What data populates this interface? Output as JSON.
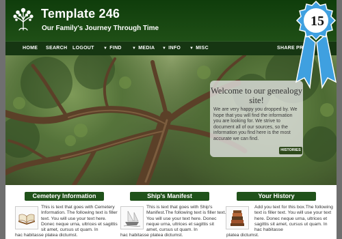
{
  "site": {
    "title": "Template 246",
    "tagline": "Our Family's Journey Through Time"
  },
  "nav": {
    "home": "HOME",
    "search": "SEARCH",
    "logout": "LOGOUT",
    "find": "FIND",
    "media": "MEDIA",
    "info": "INFO",
    "misc": "MISC",
    "share": "SHARE",
    "print": "PRINT"
  },
  "badge": {
    "number": "15"
  },
  "welcome": {
    "title": "Welcome to our genealogy site!",
    "text": "We are very happy you dropped by. We hope that you will find the information you are looking for. We strive to document all of our sources, so the information you find here is the most accurate we can find.",
    "button": "HISTORIES"
  },
  "columns": [
    {
      "heading": "Cemetery Information",
      "icon": "book-icon",
      "text": "This is text that goes with Cemetery Information. The following text is filler text. You will use your text here. Donec neque urna, ultrices et sagittis sit amet, cursus ut quam. In",
      "tail": "hac habitasse platea dictumst."
    },
    {
      "heading": "Ship's Manifest",
      "icon": "ship-icon",
      "text": "This is text that goes with Ship's Manifest.The following text is filler text. You will use your text here. Donec neque urna, ultrices et sagittis sit amet, cursus ut quam. In",
      "tail": "hac habitasse platea dictumst."
    },
    {
      "heading": "Your History",
      "icon": "books-icon",
      "text": "Add you text for this box.The following text is filler text. You will use your text here. Donec neque urna, ultrices et sagittis sit amet, cursus ut quam. In hac habitasse",
      "tail": "platea dictumst."
    }
  ],
  "colors": {
    "header_dark": "#0f3d0b",
    "nav": "#163612",
    "accent_green": "#20521a",
    "ribbon_blue": "#3fa0e0"
  }
}
